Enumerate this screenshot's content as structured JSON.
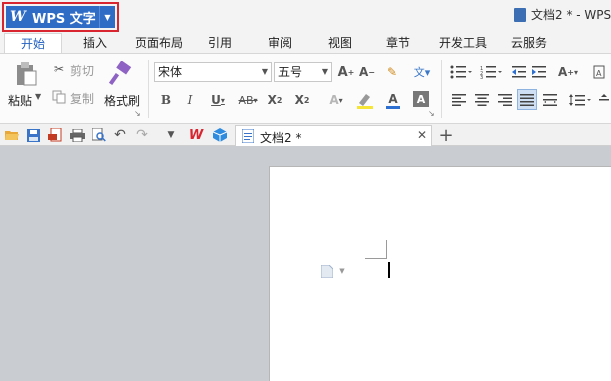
{
  "app": {
    "menu_label": "WPS 文字",
    "logo_glyph": "W",
    "document_title": "文档2 * - WPS",
    "accent_color": "#2f6cc6",
    "highlight_color": "#d9252f"
  },
  "tabs": [
    {
      "label": "开始",
      "active": true
    },
    {
      "label": "插入",
      "active": false
    },
    {
      "label": "页面布局",
      "active": false
    },
    {
      "label": "引用",
      "active": false
    },
    {
      "label": "审阅",
      "active": false
    },
    {
      "label": "视图",
      "active": false
    },
    {
      "label": "章节",
      "active": false
    },
    {
      "label": "开发工具",
      "active": false
    },
    {
      "label": "云服务",
      "active": false
    }
  ],
  "clipboard": {
    "paste_label": "粘贴",
    "cut_label": "剪切",
    "copy_label": "复制",
    "format_painter_label": "格式刷"
  },
  "font": {
    "family_value": "宋体",
    "size_value": "五号"
  },
  "document_tab": {
    "label": "文档2 *"
  }
}
